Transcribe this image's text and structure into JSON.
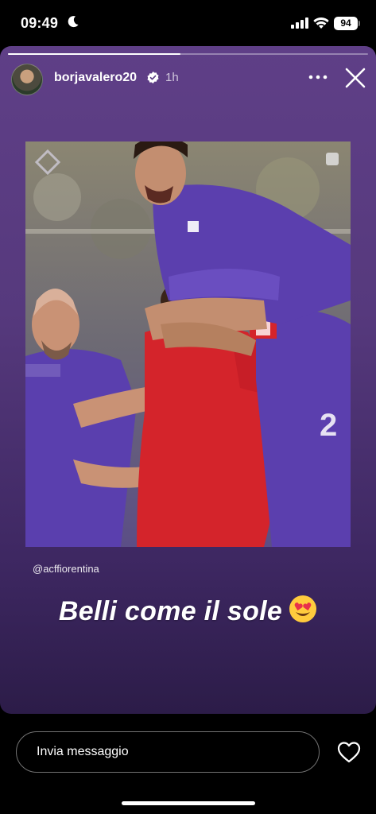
{
  "status_bar": {
    "time": "09:49",
    "battery": "94"
  },
  "story": {
    "username": "borjavalero20",
    "age": "1h",
    "progress": 0.48,
    "mention": "@acffiorentina",
    "caption": "Belli come il sole"
  },
  "reply": {
    "placeholder": "Invia messaggio"
  },
  "colors": {
    "story_bg_top": "#5f3f87",
    "story_bg_bottom": "#2c1c48",
    "fiorentina_purple": "#5b3fae",
    "keeper_red": "#d4242b"
  },
  "icons": [
    "moon-icon",
    "signal-icon",
    "wifi-icon",
    "battery-icon",
    "verified-icon",
    "more-icon",
    "close-icon",
    "heart-eyes-emoji",
    "heart-icon"
  ]
}
